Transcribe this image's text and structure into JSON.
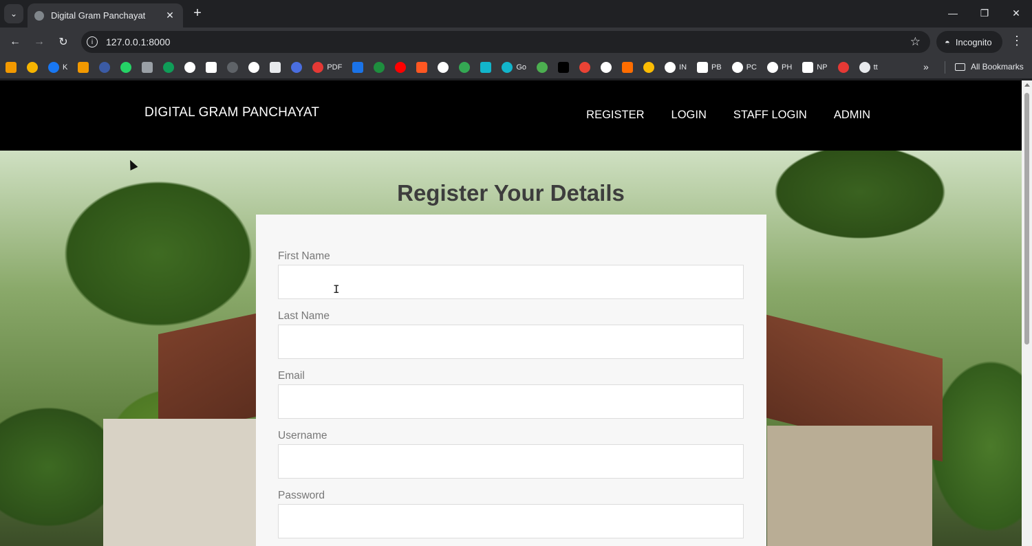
{
  "browser": {
    "tab_title": "Digital Gram Panchayat",
    "url": "127.0.0.1:8000",
    "incognito_label": "Incognito",
    "all_bookmarks_label": "All Bookmarks",
    "bookmarks": [
      {
        "label": "",
        "color": "#f29900"
      },
      {
        "label": "",
        "color": "#f6b400"
      },
      {
        "label": "K",
        "color": "#1877f2"
      },
      {
        "label": "",
        "color": "#f29900"
      },
      {
        "label": "",
        "color": "#3b5ba5"
      },
      {
        "label": "",
        "color": "#25d366"
      },
      {
        "label": "",
        "color": "#9aa0a6"
      },
      {
        "label": "",
        "color": "#0f9d58"
      },
      {
        "label": "",
        "color": "#ffffff"
      },
      {
        "label": "",
        "color": "#ffffff"
      },
      {
        "label": "",
        "color": "#5f6368"
      },
      {
        "label": "",
        "color": "#ffffff"
      },
      {
        "label": "",
        "color": "#e8eaed"
      },
      {
        "label": "",
        "color": "#4a6ee0"
      },
      {
        "label": "PDF",
        "color": "#e53935"
      },
      {
        "label": "",
        "color": "#1a73e8"
      },
      {
        "label": "",
        "color": "#1e8e3e"
      },
      {
        "label": "",
        "color": "#ff0000"
      },
      {
        "label": "",
        "color": "#ff5722"
      },
      {
        "label": "",
        "color": "#ffffff"
      },
      {
        "label": "",
        "color": "#34a853"
      },
      {
        "label": "",
        "color": "#12b5cb"
      },
      {
        "label": "Go",
        "color": "#12b5cb"
      },
      {
        "label": "",
        "color": "#4caf50"
      },
      {
        "label": "",
        "color": "#000000"
      },
      {
        "label": "",
        "color": "#ea4335"
      },
      {
        "label": "",
        "color": "#ffffff"
      },
      {
        "label": "",
        "color": "#ff6d00"
      },
      {
        "label": "",
        "color": "#fbbc04"
      },
      {
        "label": "IN",
        "color": "#ffffff"
      },
      {
        "label": "PB",
        "color": "#ffffff"
      },
      {
        "label": "PC",
        "color": "#ffffff"
      },
      {
        "label": "PH",
        "color": "#ffffff"
      },
      {
        "label": "NP",
        "color": "#ffffff"
      },
      {
        "label": "",
        "color": "#e53935"
      },
      {
        "label": "tt",
        "color": "#e8eaed"
      }
    ]
  },
  "site": {
    "logo": "DIGITAL GRAM PANCHAYAT",
    "nav": [
      "REGISTER",
      "LOGIN",
      "STAFF LOGIN",
      "ADMIN"
    ]
  },
  "form": {
    "title": "Register Your Details",
    "fields": [
      {
        "label": "First Name",
        "value": ""
      },
      {
        "label": "Last Name",
        "value": ""
      },
      {
        "label": "Email",
        "value": ""
      },
      {
        "label": "Username",
        "value": ""
      },
      {
        "label": "Password",
        "value": ""
      }
    ]
  }
}
